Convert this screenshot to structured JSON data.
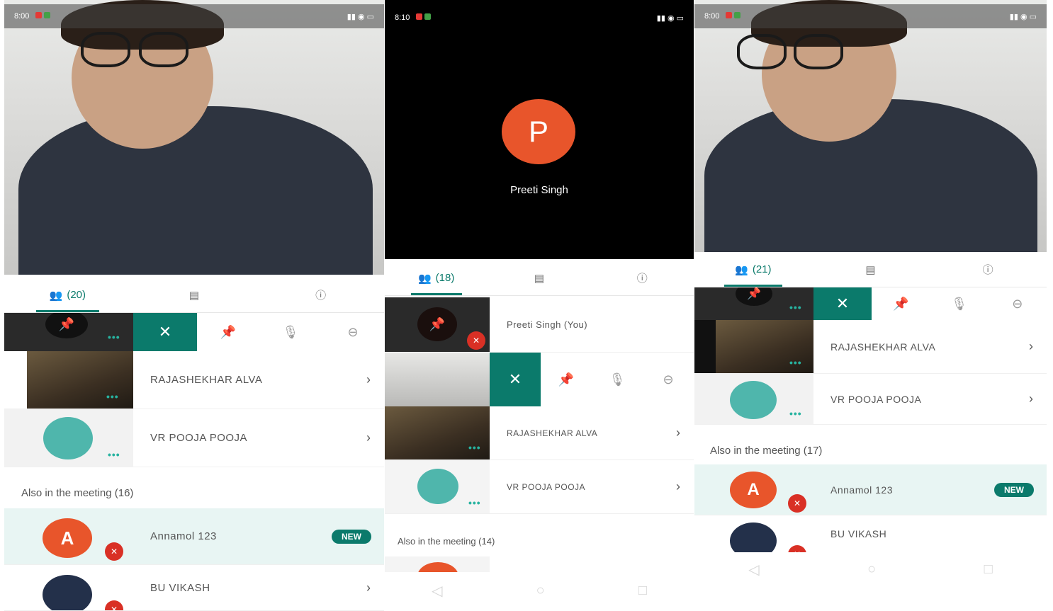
{
  "status": {
    "left_time_1": "8:00",
    "left_time_2": "8:10",
    "left_time_3": "8:00"
  },
  "panel1": {
    "participants_tab": "(20)",
    "rows": [
      {
        "name": "RAJASHEKHAR ALVA"
      },
      {
        "name": "VR POOJA POOJA"
      }
    ],
    "section": "Also in the meeting (16)",
    "also": [
      {
        "initial": "A",
        "name": "Annamol 123",
        "badge": "NEW"
      },
      {
        "name": "BU VIKASH"
      }
    ]
  },
  "panel2": {
    "avatar_initial": "P",
    "presenter_name": "Preeti Singh",
    "participants_tab": "(18)",
    "self_name": "Preeti Singh (You)",
    "rows": [
      {
        "name": "RAJASHEKHAR ALVA"
      },
      {
        "name": "VR POOJA POOJA"
      }
    ],
    "section": "Also in the meeting (14)"
  },
  "panel3": {
    "participants_tab": "(21)",
    "rows": [
      {
        "name": "RAJASHEKHAR ALVA"
      },
      {
        "name": "VR POOJA POOJA"
      }
    ],
    "section": "Also in the meeting (17)",
    "also": [
      {
        "initial": "A",
        "name": "Annamol 123",
        "badge": "NEW"
      },
      {
        "name": "BU VIKASH"
      }
    ]
  },
  "colors": {
    "accent": "#0b7a6b",
    "avatar_orange": "#e8552b",
    "highlight_row": "#e8f5f3",
    "mute_red": "#d93025"
  },
  "icons": {
    "people": "people-icon",
    "chat": "chat-icon",
    "info": "info-icon",
    "pin": "pin-icon",
    "mute": "mute-icon",
    "remove": "remove-icon",
    "close": "close-icon"
  }
}
